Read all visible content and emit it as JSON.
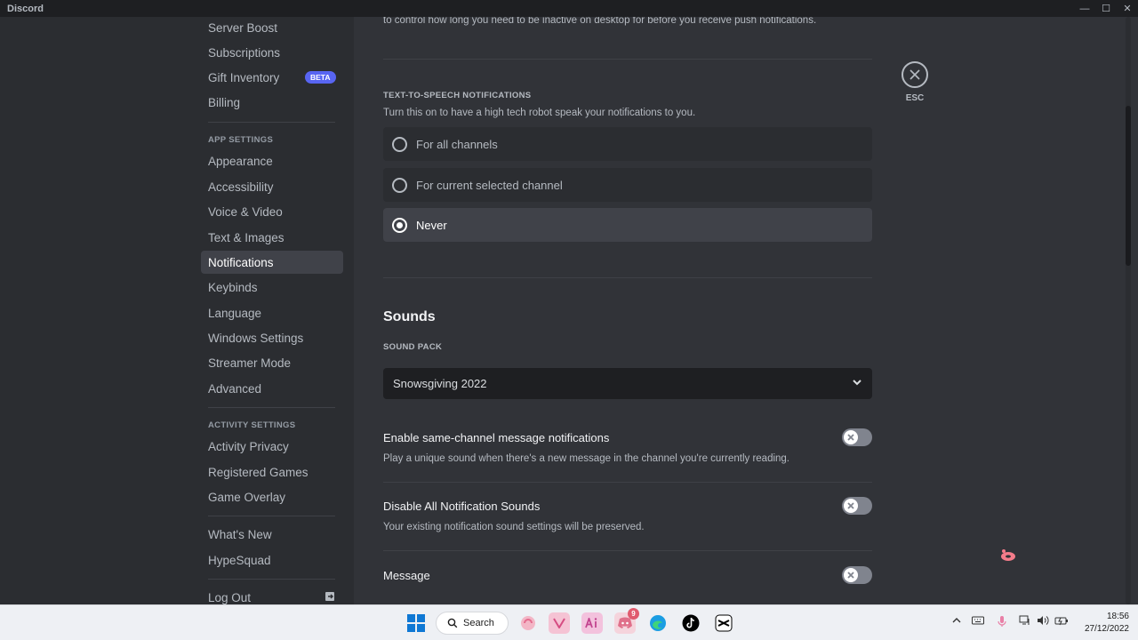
{
  "window": {
    "title": "Discord"
  },
  "sidebar": {
    "items_top": [
      {
        "label": "Server Boost"
      },
      {
        "label": "Subscriptions"
      },
      {
        "label": "Gift Inventory",
        "badge": "BETA"
      },
      {
        "label": "Billing"
      }
    ],
    "app_settings_header": "APP SETTINGS",
    "app_items": [
      {
        "label": "Appearance"
      },
      {
        "label": "Accessibility"
      },
      {
        "label": "Voice & Video"
      },
      {
        "label": "Text & Images"
      },
      {
        "label": "Notifications",
        "active": true
      },
      {
        "label": "Keybinds"
      },
      {
        "label": "Language"
      },
      {
        "label": "Windows Settings"
      },
      {
        "label": "Streamer Mode"
      },
      {
        "label": "Advanced"
      }
    ],
    "activity_settings_header": "ACTIVITY SETTINGS",
    "activity_items": [
      {
        "label": "Activity Privacy"
      },
      {
        "label": "Registered Games"
      },
      {
        "label": "Game Overlay"
      }
    ],
    "misc_items": [
      {
        "label": "What's New"
      },
      {
        "label": "HypeSquad"
      }
    ],
    "logout_label": "Log Out"
  },
  "content": {
    "top_desc": "to control how long you need to be inactive on desktop for before you receive push notifications.",
    "tts": {
      "header": "TEXT-TO-SPEECH NOTIFICATIONS",
      "desc": "Turn this on to have a high tech robot speak your notifications to you.",
      "options": [
        {
          "label": "For all channels",
          "selected": false
        },
        {
          "label": "For current selected channel",
          "selected": false
        },
        {
          "label": "Never",
          "selected": true
        }
      ]
    },
    "sounds": {
      "title": "Sounds",
      "pack_header": "SOUND PACK",
      "pack_value": "Snowsgiving 2022",
      "settings": [
        {
          "title": "Enable same-channel message notifications",
          "desc": "Play a unique sound when there's a new message in the channel you're currently reading.",
          "enabled": false
        },
        {
          "title": "Disable All Notification Sounds",
          "desc": "Your existing notification sound settings will be preserved.",
          "enabled": false
        },
        {
          "title": "Message",
          "desc": "",
          "enabled": false
        }
      ]
    },
    "esc_label": "ESC"
  },
  "taskbar": {
    "search_label": "Search",
    "discord_badge": "9",
    "time": "18:56",
    "date": "27/12/2022"
  },
  "colors": {
    "accent": "#5865f2",
    "sidebar_bg": "#2b2d31",
    "content_bg": "#313338",
    "selected_bg": "#404249"
  }
}
